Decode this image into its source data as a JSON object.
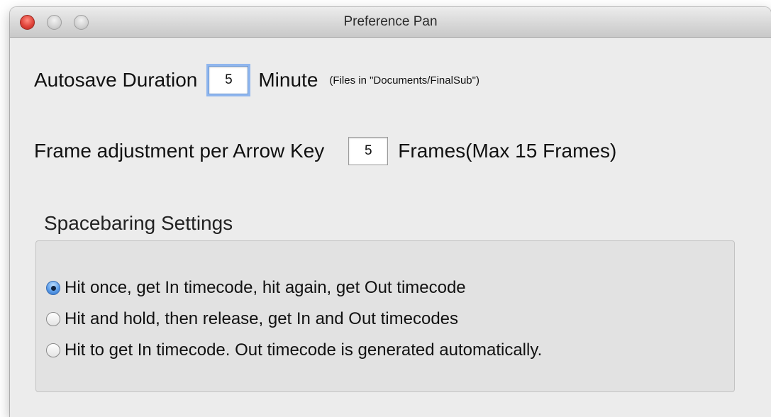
{
  "window": {
    "title": "Preference Pan"
  },
  "autosave": {
    "label": "Autosave Duration",
    "value": "5",
    "unit": "Minute",
    "note": "(Files in \"Documents/FinalSub\")"
  },
  "frame_adjust": {
    "label": "Frame adjustment per Arrow Key",
    "value": "5",
    "unit": "Frames(Max 15 Frames)"
  },
  "spacebaring": {
    "title": "Spacebaring Settings",
    "selected_index": 0,
    "options": [
      {
        "label": "Hit once, get In timecode, hit again, get Out timecode",
        "checked": true
      },
      {
        "label": "Hit and hold, then release, get In and Out timecodes",
        "checked": false
      },
      {
        "label": "Hit to get In timecode. Out timecode is generated automatically.",
        "checked": false
      }
    ]
  },
  "colors": {
    "close_button": "#e0443a",
    "focus_ring": "#8fb6ee",
    "radio_selected": "#5d9ee9",
    "window_bg": "#ececec"
  }
}
